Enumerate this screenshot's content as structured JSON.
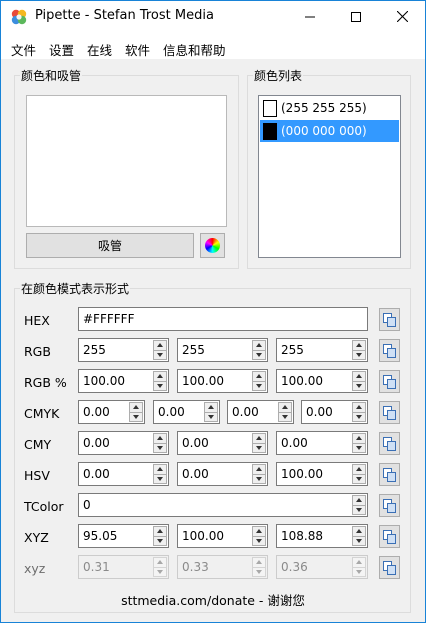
{
  "window": {
    "title": "Pipette - Stefan Trost Media"
  },
  "menu": [
    "文件",
    "设置",
    "在线",
    "软件",
    "信息和帮助"
  ],
  "color_group": {
    "title": "颜色和吸管",
    "pick_button": "吸管"
  },
  "list_group": {
    "title": "颜色列表",
    "items": [
      {
        "label": "(255 255 255)",
        "swatch": "#ffffff",
        "selected": false
      },
      {
        "label": "(000 000 000)",
        "swatch": "#000000",
        "selected": true
      }
    ]
  },
  "models_group": {
    "title": "在颜色模式表示形式"
  },
  "rows": {
    "hex": {
      "label": "HEX",
      "values": [
        "#FFFFFF"
      ]
    },
    "rgb": {
      "label": "RGB",
      "values": [
        "255",
        "255",
        "255"
      ]
    },
    "rgb_pct": {
      "label": "RGB %",
      "values": [
        "100.00",
        "100.00",
        "100.00"
      ]
    },
    "cmyk": {
      "label": "CMYK",
      "values": [
        "0.00",
        "0.00",
        "0.00",
        "0.00"
      ]
    },
    "cmy": {
      "label": "CMY",
      "values": [
        "0.00",
        "0.00",
        "0.00"
      ]
    },
    "hsv": {
      "label": "HSV",
      "values": [
        "0.00",
        "0.00",
        "100.00"
      ]
    },
    "tcolor": {
      "label": "TColor",
      "values": [
        "0"
      ]
    },
    "xyz": {
      "label": "XYZ",
      "values": [
        "95.05",
        "100.00",
        "108.88"
      ]
    },
    "xyz_lower": {
      "label": "xyz",
      "values": [
        "0.31",
        "0.33",
        "0.36"
      ]
    }
  },
  "footer": {
    "link": "sttmedia.com/donate - 谢谢您"
  },
  "icons": {
    "app": "pipette-app-icon",
    "copy": "copy-icon",
    "wheel": "color-wheel-icon"
  }
}
